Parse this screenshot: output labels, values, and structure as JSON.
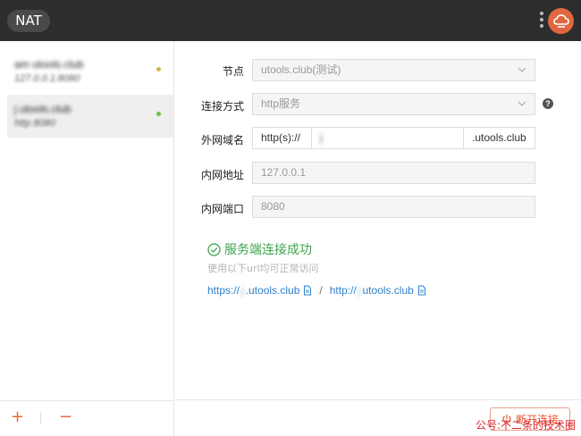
{
  "header": {
    "app_name": "NAT"
  },
  "sidebar": {
    "connections": [
      {
        "name": "am utools.club",
        "sub": "127.0.0.1:8080",
        "status_color": "#d4b64a",
        "active": false
      },
      {
        "name": "j utools.club",
        "sub": "http 8080",
        "status_color": "#6cc04a",
        "active": true
      }
    ],
    "add_label": "+",
    "remove_label": "−"
  },
  "form": {
    "node": {
      "label": "节点",
      "value": "utools.club(测试)"
    },
    "method": {
      "label": "连接方式",
      "value": "http服务",
      "help": "?"
    },
    "domain": {
      "label": "外网域名",
      "prefix": "http(s)://",
      "value": "j",
      "suffix": ".utools.club"
    },
    "address": {
      "label": "内网地址",
      "value": "127.0.0.1"
    },
    "port": {
      "label": "内网端口",
      "value": "8080"
    }
  },
  "status": {
    "success_text": "服务端连接成功",
    "hint": "使用以下url均可正常访问",
    "https_prefix": "https://",
    "https_blur": "j",
    "https_suffix": ".utools.club",
    "separator": "/",
    "http_prefix": "http://",
    "http_blur": "j",
    "http_suffix": "utools.club"
  },
  "footer": {
    "disconnect_label": "断开连接",
    "watermark": "公号:不二条的技术圈"
  },
  "colors": {
    "accent": "#e8552c",
    "success": "#3fa34d",
    "link": "#2f80c8"
  }
}
